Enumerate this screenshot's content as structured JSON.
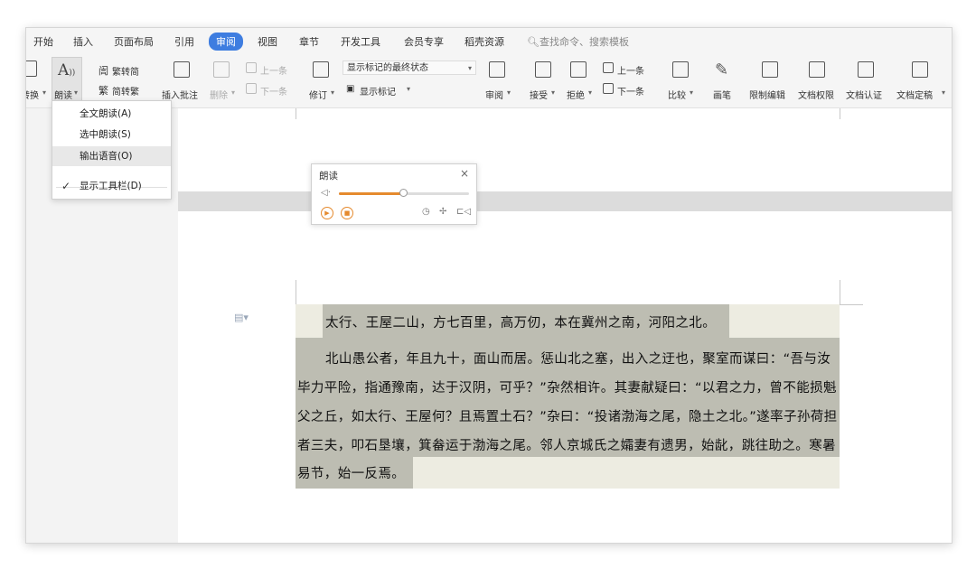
{
  "menubar": {
    "tabs": [
      "开始",
      "插入",
      "页面布局",
      "引用",
      "审阅",
      "视图",
      "章节",
      "开发工具",
      "会员专享",
      "稻壳资源"
    ],
    "active_tab": "审阅",
    "search_placeholder": "查找命令、搜索模板"
  },
  "ribbon": {
    "convert_label": "转换",
    "read_aloud_label": "朗读",
    "trad_to_simp": "繁转简",
    "simp_to_trad": "简转繁",
    "insert_comment": "插入批注",
    "delete": "删除",
    "prev_comment": "上一条",
    "next_comment": "下一条",
    "track_changes": "修订",
    "display_state": "显示标记的最终状态",
    "show_markup": "显示标记",
    "review_pane": "审阅",
    "accept": "接受",
    "reject": "拒绝",
    "prev_change": "上一条",
    "next_change": "下一条",
    "compare": "比较",
    "pen": "画笔",
    "restrict_editing": "限制编辑",
    "doc_permission": "文档权限",
    "doc_certify": "文档认证",
    "doc_finalize": "文档定稿"
  },
  "read_menu": {
    "options": [
      "全文朗读(A)",
      "选中朗读(S)",
      "输出语音(O)",
      "显示工具栏(D)"
    ],
    "highlighted": "输出语音(O)",
    "checked": "显示工具栏(D)"
  },
  "reader_panel": {
    "title": "朗读",
    "close": "×",
    "volume_level": 0.49
  },
  "document": {
    "lines": [
      "太行、王屋二山，方七百里，高万仞，本在冀州之南，河阳之北。",
      "北山愚公者，年且九十，面山而居。惩山北之塞，出入之迂也，聚室而谋曰：“吾与汝",
      "毕力平险，指通豫南，达于汉阴，可乎？”杂然相许。其妻献疑曰：“以君之力，曾不能损魁",
      "父之丘，如太行、王屋何？且焉置土石？”杂曰：“投诸渤海之尾，隐土之北。”遂率子孙荷担",
      "者三夫，叩石垦壤，箕畚运于渤海之尾。邻人京城氏之孀妻有遗男，始龀，跳往助之。寒暑",
      "易节，始一反焉。"
    ]
  }
}
